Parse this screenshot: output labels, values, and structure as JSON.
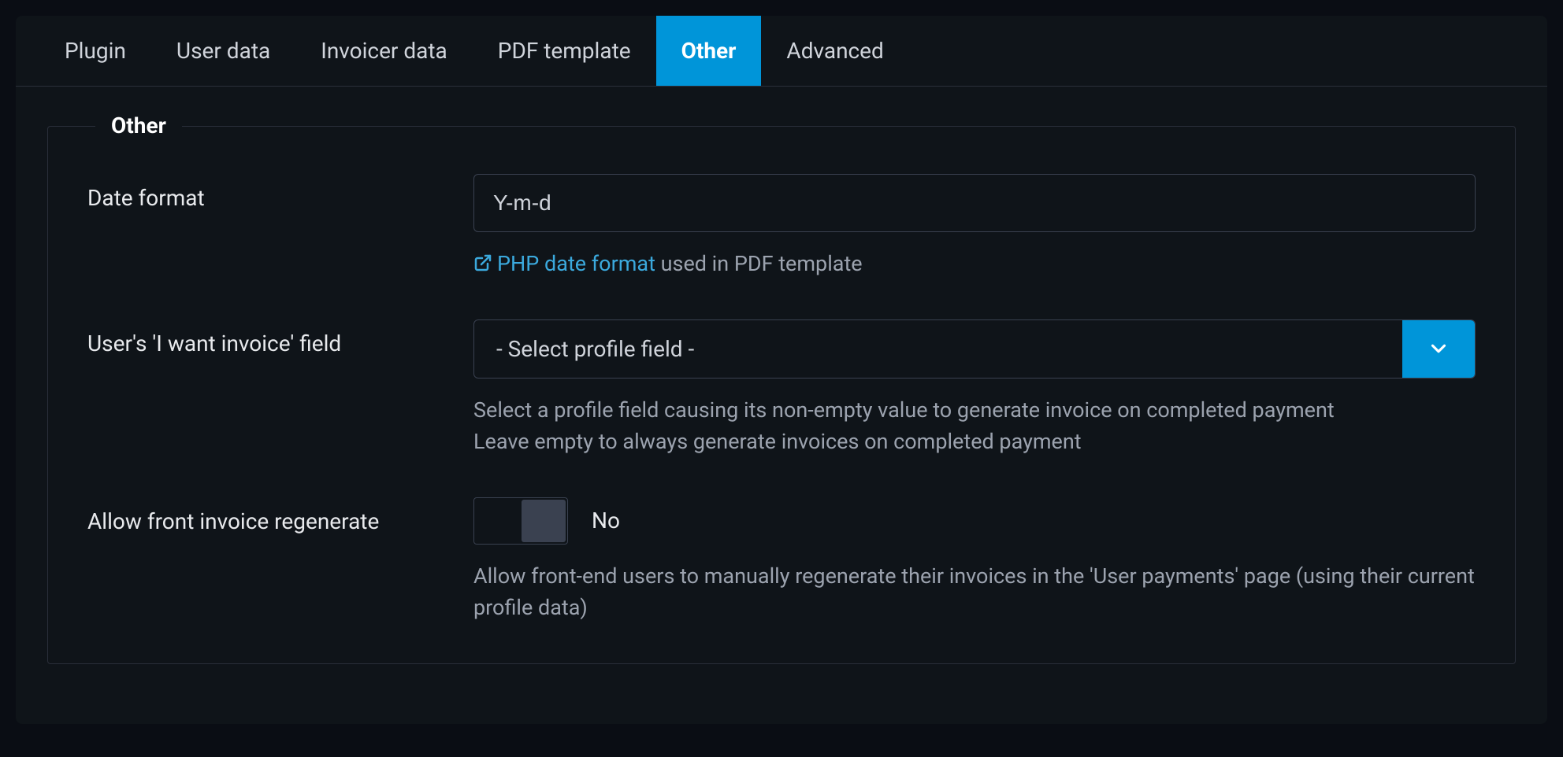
{
  "tabs": {
    "plugin": "Plugin",
    "user_data": "User data",
    "invoicer_data": "Invoicer data",
    "pdf_template": "PDF template",
    "other": "Other",
    "advanced": "Advanced"
  },
  "section": {
    "title": "Other"
  },
  "fields": {
    "date_format": {
      "label": "Date format",
      "value": "Y-m-d",
      "help_link": "PHP date format",
      "help_suffix": " used in PDF template"
    },
    "want_invoice": {
      "label": "User's 'I want invoice' field",
      "selected": "- Select profile field -",
      "help_line1": "Select a profile field causing its non-empty value to generate invoice on completed payment",
      "help_line2": "Leave empty to always generate invoices on completed payment"
    },
    "allow_regenerate": {
      "label": "Allow front invoice regenerate",
      "state": "No",
      "help": "Allow front-end users to manually regenerate their invoices in the 'User payments' page (using their current profile data)"
    }
  }
}
